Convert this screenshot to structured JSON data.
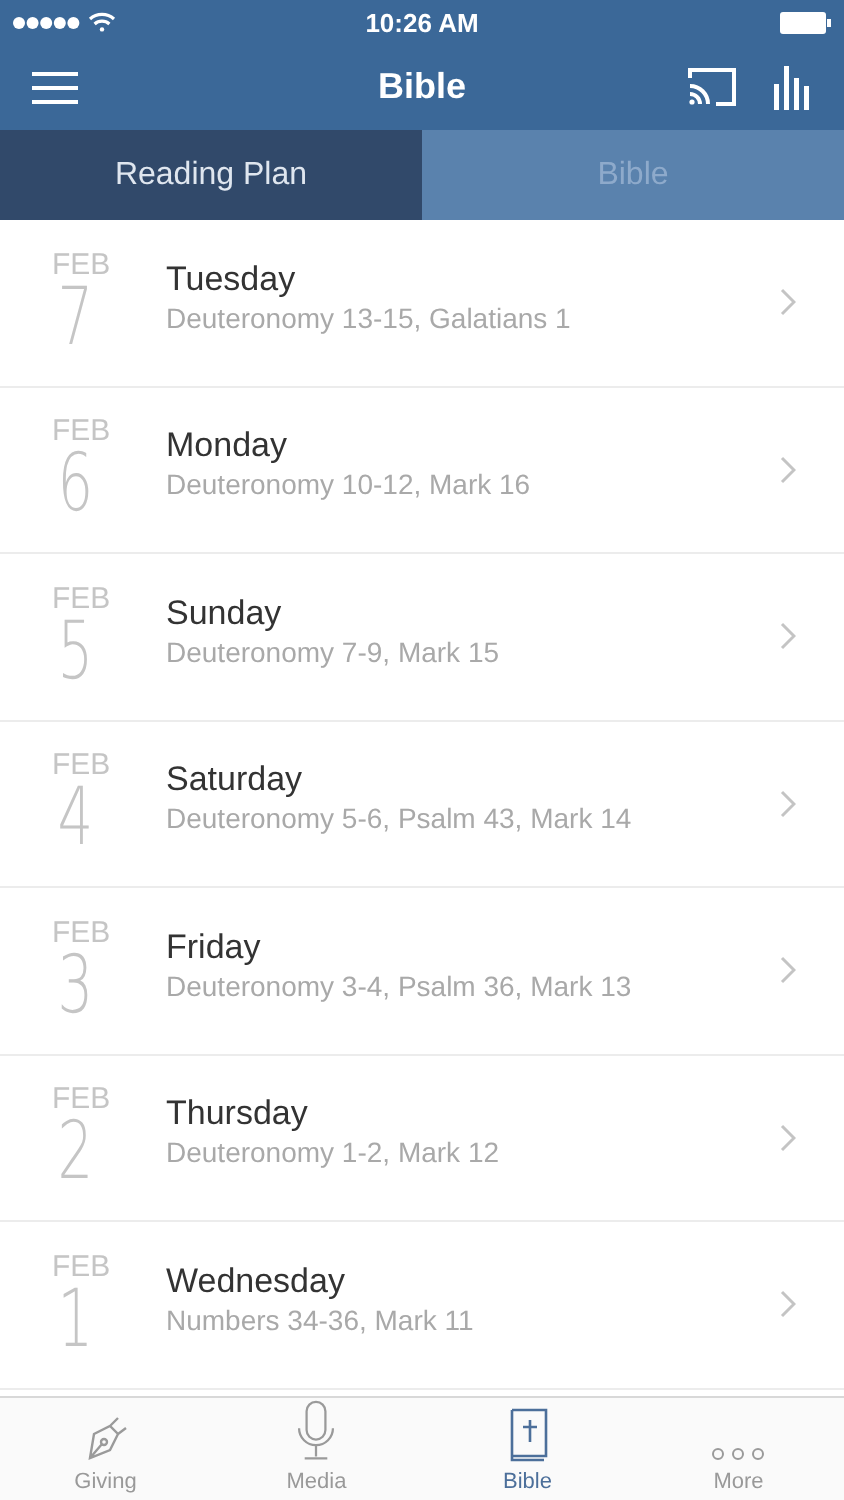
{
  "status_bar": {
    "time": "10:26 AM"
  },
  "nav": {
    "title": "Bible"
  },
  "tabs": [
    {
      "label": "Reading Plan",
      "selected": true
    },
    {
      "label": "Bible",
      "selected": false
    }
  ],
  "plan": [
    {
      "month": "FEB",
      "day": "7",
      "weekday": "Tuesday",
      "readings": "Deuteronomy 13-15, Galatians 1"
    },
    {
      "month": "FEB",
      "day": "6",
      "weekday": "Monday",
      "readings": "Deuteronomy 10-12, Mark 16"
    },
    {
      "month": "FEB",
      "day": "5",
      "weekday": "Sunday",
      "readings": "Deuteronomy 7-9, Mark 15"
    },
    {
      "month": "FEB",
      "day": "4",
      "weekday": "Saturday",
      "readings": "Deuteronomy 5-6, Psalm 43, Mark 14"
    },
    {
      "month": "FEB",
      "day": "3",
      "weekday": "Friday",
      "readings": "Deuteronomy 3-4, Psalm 36, Mark 13"
    },
    {
      "month": "FEB",
      "day": "2",
      "weekday": "Thursday",
      "readings": "Deuteronomy 1-2, Mark 12"
    },
    {
      "month": "FEB",
      "day": "1",
      "weekday": "Wednesday",
      "readings": "Numbers 34-36, Mark 11"
    }
  ],
  "tab_bar": [
    {
      "kind": "pen",
      "label": "Giving",
      "selected": false
    },
    {
      "kind": "mic",
      "label": "Media",
      "selected": false
    },
    {
      "kind": "book",
      "label": "Bible",
      "selected": true
    },
    {
      "kind": "more",
      "label": "More",
      "selected": false
    }
  ]
}
